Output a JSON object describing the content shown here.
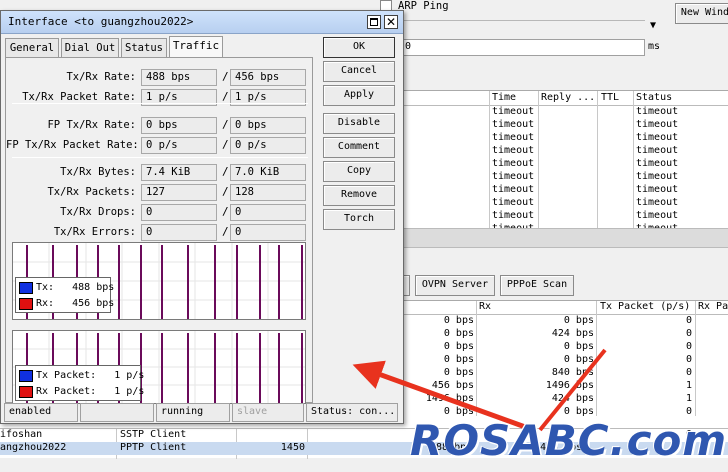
{
  "background": {
    "arp_ping_label": "ARP Ping",
    "new_window_label": "New Wind",
    "ms_value": "0",
    "ms_unit": "ms",
    "ping_columns": [
      "Time",
      "Reply ...",
      "TTL",
      "Status"
    ],
    "ping_rows": [
      {
        "time": "timeout",
        "status": "timeout"
      },
      {
        "time": "timeout",
        "status": "timeout"
      },
      {
        "time": "timeout",
        "status": "timeout"
      },
      {
        "time": "timeout",
        "status": "timeout"
      },
      {
        "time": "timeout",
        "status": "timeout"
      },
      {
        "time": "timeout",
        "status": "timeout"
      },
      {
        "time": "timeout",
        "status": "timeout"
      },
      {
        "time": "timeout",
        "status": "timeout"
      },
      {
        "time": "timeout",
        "status": "timeout"
      },
      {
        "time": "timeout",
        "status": "timeout"
      }
    ],
    "add_buttons": [
      "OVPN Server",
      "PPPoE Scan"
    ],
    "iface_columns": [
      "Rx",
      "Tx Packet (p/s)",
      "Rx Pa"
    ],
    "iface_rows": [
      {
        "tx": "0 bps",
        "rx": "0 bps",
        "txp": "0"
      },
      {
        "tx": "0 bps",
        "rx": "424 bps",
        "txp": "0"
      },
      {
        "tx": "0 bps",
        "rx": "0 bps",
        "txp": "0"
      },
      {
        "tx": "0 bps",
        "rx": "0 bps",
        "txp": "0"
      },
      {
        "tx": "0 bps",
        "rx": "840 bps",
        "txp": "0"
      },
      {
        "tx": "456 bps",
        "rx": "1496 bps",
        "txp": "1"
      },
      {
        "tx": "1496 bps",
        "rx": "424 bps",
        "txp": "1"
      },
      {
        "tx": "0 bps",
        "rx": "0 bps",
        "txp": "0"
      }
    ],
    "bottom_rows": [
      {
        "name": "ifoshan",
        "type": "SSTP Client",
        "mtu": "",
        "tx": "",
        "rx": "",
        "txp": "0"
      },
      {
        "name": "angzhou2022",
        "type": "PPTP Client",
        "mtu": "1450",
        "tx": "488 bps",
        "rx": "456 bps",
        "txp": "1"
      }
    ]
  },
  "dialog": {
    "title": "Interface <to guangzhou2022>",
    "tabs": [
      "General",
      "Dial Out",
      "Status",
      "Traffic"
    ],
    "active_tab": "Traffic",
    "stats": [
      {
        "label": "Tx/Rx Rate:",
        "tx": "488 bps",
        "rx": "456 bps"
      },
      {
        "label": "Tx/Rx Packet Rate:",
        "tx": "1 p/s",
        "rx": "1 p/s"
      },
      {
        "label": "FP Tx/Rx Rate:",
        "tx": "0 bps",
        "rx": "0 bps"
      },
      {
        "label": "FP Tx/Rx Packet Rate:",
        "tx": "0 p/s",
        "rx": "0 p/s"
      },
      {
        "label": "Tx/Rx Bytes:",
        "tx": "7.4 KiB",
        "rx": "7.0 KiB"
      },
      {
        "label": "Tx/Rx Packets:",
        "tx": "127",
        "rx": "128"
      },
      {
        "label": "Tx/Rx Drops:",
        "tx": "0",
        "rx": "0"
      },
      {
        "label": "Tx/Rx Errors:",
        "tx": "0",
        "rx": "0"
      }
    ],
    "graph1_legend": [
      {
        "label": "Tx:   488 bps",
        "color": "#1030e0"
      },
      {
        "label": "Rx:   456 bps",
        "color": "#e01010"
      }
    ],
    "graph2_legend": [
      {
        "label": "Tx Packet:   1 p/s",
        "color": "#1030e0"
      },
      {
        "label": "Rx Packet:   1 p/s",
        "color": "#e01010"
      }
    ],
    "buttons": [
      "OK",
      "Cancel",
      "Apply",
      "Disable",
      "Comment",
      "Copy",
      "Remove",
      "Torch"
    ],
    "status": [
      "enabled",
      "",
      "running",
      "slave",
      "Status: con..."
    ]
  },
  "watermark": "ROSABC.com"
}
